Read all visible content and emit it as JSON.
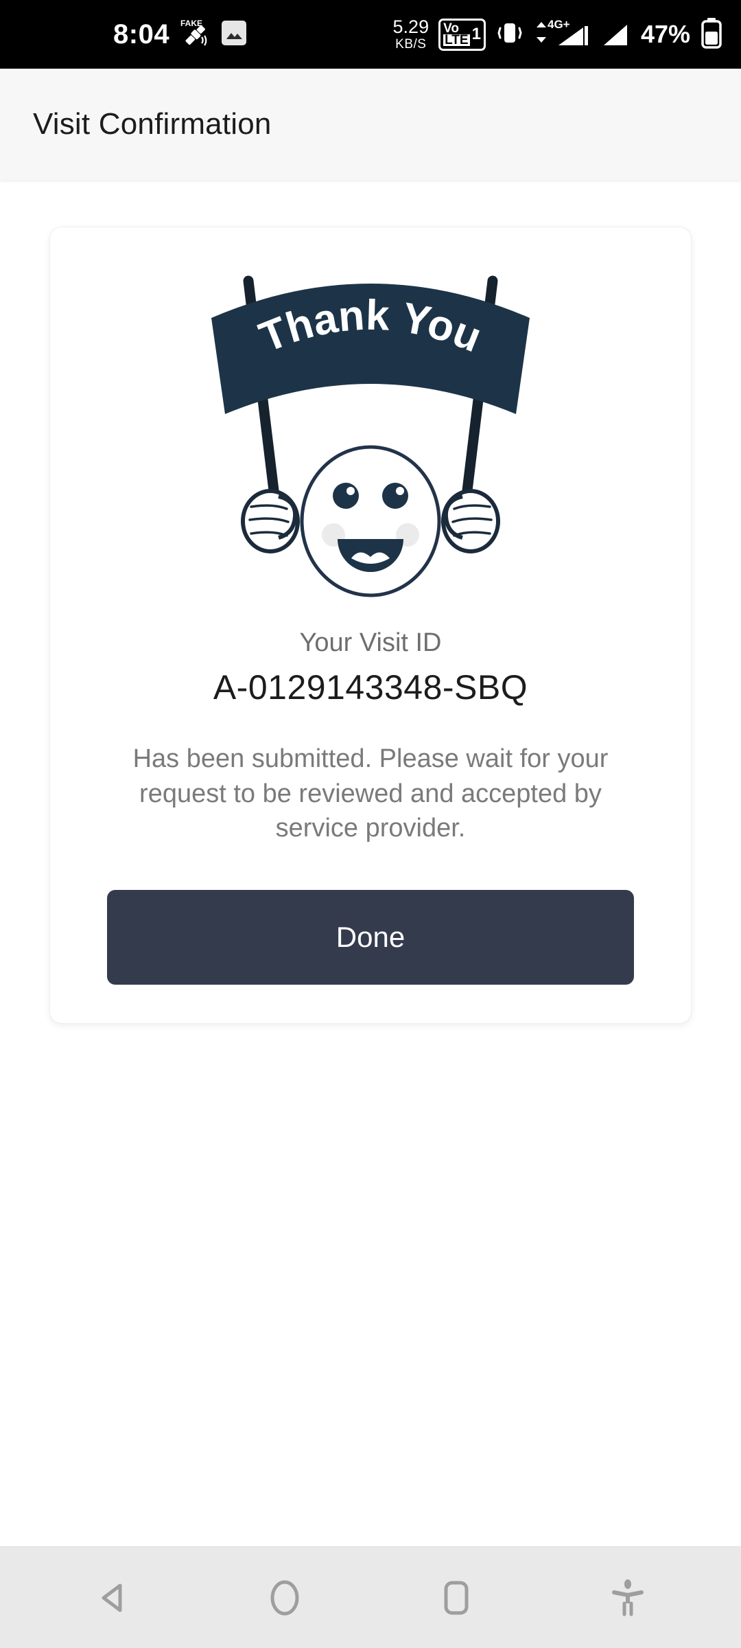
{
  "status_bar": {
    "time": "8:04",
    "icons_left": [
      "fake-gps-satellite-icon",
      "gallery-image-icon"
    ],
    "network_speed_value": "5.29",
    "network_speed_unit": "KB/S",
    "volte_line1": "Vo",
    "volte_line2": "LTE",
    "volte_sim": "1",
    "vibrate_icon": "vibrate-icon",
    "network_generation": "4G+",
    "signal_icons": [
      "signal-bars-sim1-icon",
      "signal-bars-sim2-icon"
    ],
    "battery_percent": "47%",
    "battery_icon": "battery-icon"
  },
  "app_bar": {
    "title": "Visit Confirmation"
  },
  "card": {
    "illustration": {
      "name": "thank-you-banner-illustration",
      "banner_text": "Thank You",
      "banner_color": "#1d3448",
      "pole_color": "#16222e",
      "face_outline_color": "#22334a",
      "blush_color": "#ebebeb"
    },
    "visit_id_label": "Your Visit ID",
    "visit_id_value": "A-0129143348-SBQ",
    "status_message": "Has been submitted. Please wait for your request to be reviewed and accepted by service provider.",
    "done_button_label": "Done",
    "done_button_color": "#343b4c"
  },
  "nav_bar": {
    "back": "back-icon",
    "home": "home-icon",
    "recents": "recents-icon",
    "accessibility": "accessibility-icon",
    "icon_color": "#9e9e9e"
  }
}
